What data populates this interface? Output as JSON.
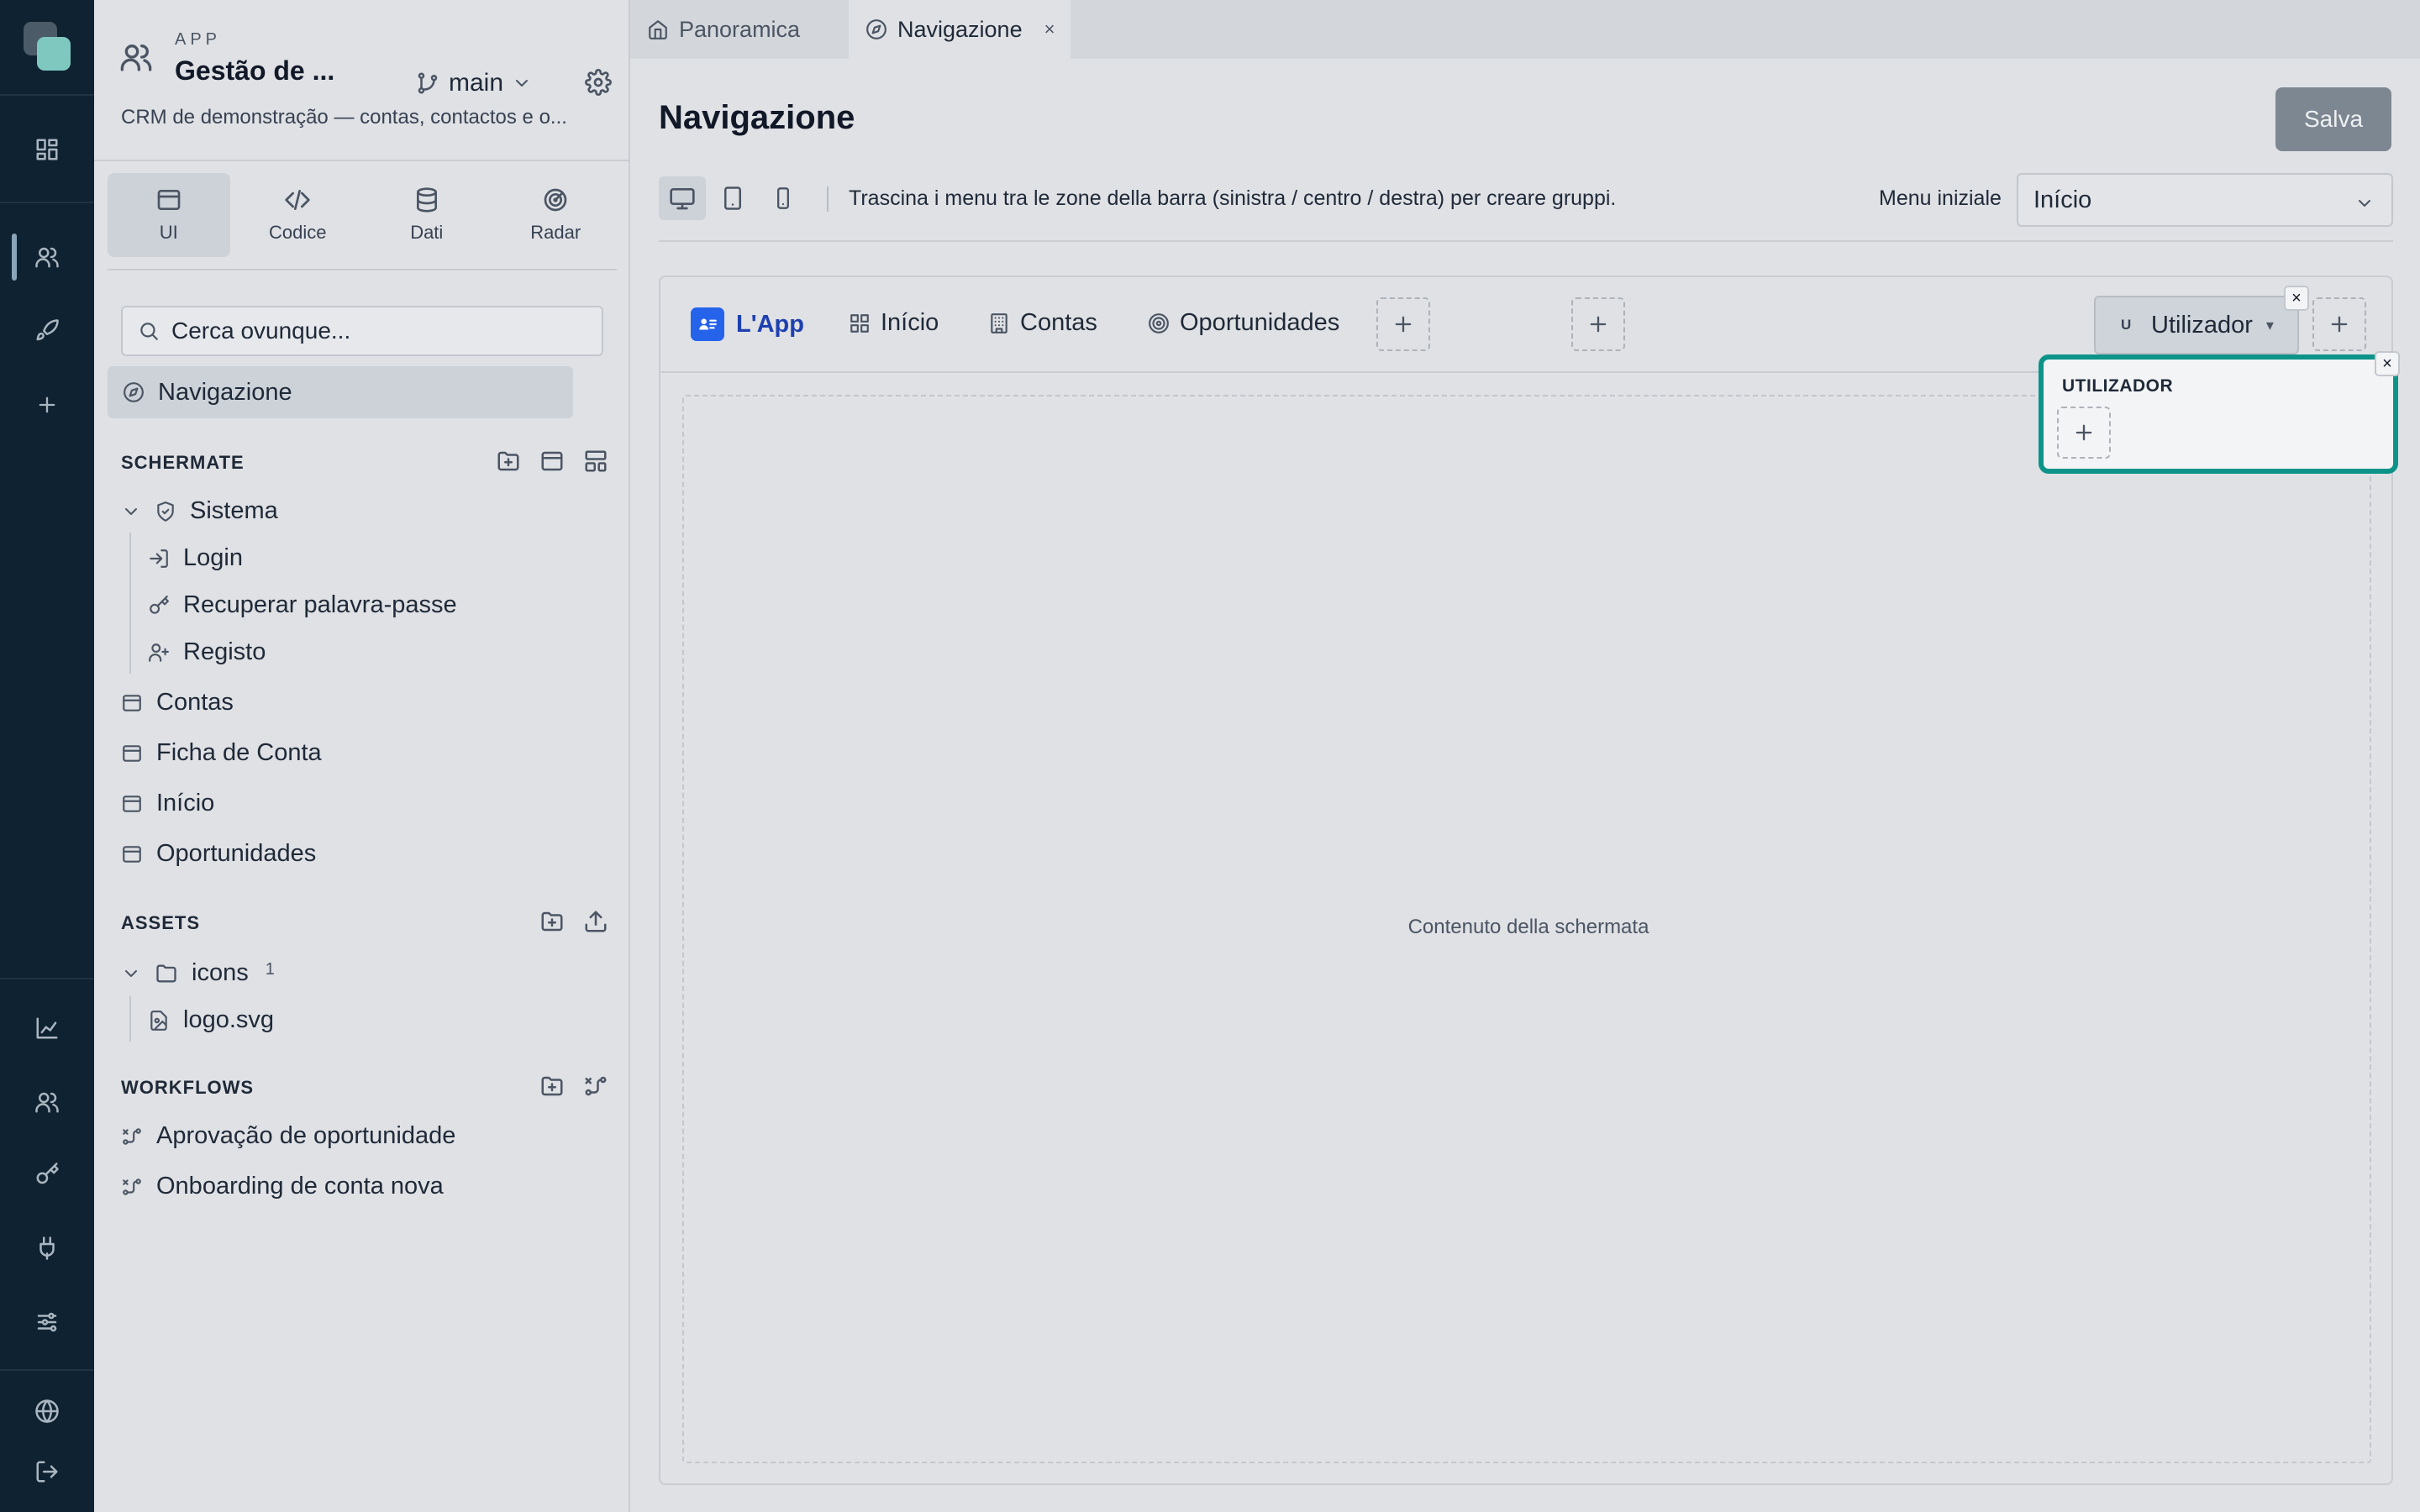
{
  "app": {
    "label": "APP",
    "title": "Gestão de ...",
    "description": "CRM de demonstração — contas, contactos e o...",
    "branch": "main"
  },
  "modes": [
    {
      "label": "UI",
      "icon": "window-icon"
    },
    {
      "label": "Codice",
      "icon": "code-icon"
    },
    {
      "label": "Dati",
      "icon": "database-icon"
    },
    {
      "label": "Radar",
      "icon": "radar-icon"
    }
  ],
  "search": {
    "placeholder": "Cerca ovunque..."
  },
  "nav_item": "Navigazione",
  "sections": {
    "screens": "SCHERMATE",
    "assets": "ASSETS",
    "workflows": "WORKFLOWS"
  },
  "screens": {
    "group": "Sistema",
    "children": [
      "Login",
      "Recuperar palavra-passe",
      "Registo"
    ],
    "items": [
      "Contas",
      "Ficha de Conta",
      "Início",
      "Oportunidades"
    ]
  },
  "assets": {
    "folder": "icons",
    "count": "1",
    "files": [
      "logo.svg"
    ]
  },
  "workflows": [
    "Aprovação de oportunidade",
    "Onboarding de conta nova"
  ],
  "tabs": [
    {
      "label": "Panoramica",
      "icon": "home-icon"
    },
    {
      "label": "Navigazione",
      "icon": "compass-icon",
      "close": "×"
    }
  ],
  "page": {
    "title": "Navigazione",
    "save_label": "Salva"
  },
  "toolbar": {
    "hint": "Trascina i menu tra le zone della barra (sinistra / centro / destra) per creare gruppi.",
    "menu_label": "Menu iniziale",
    "menu_value": "Início"
  },
  "preview": {
    "brand": "L'App",
    "items": [
      "Início",
      "Contas",
      "Oportunidades"
    ],
    "user_initial": "U",
    "user_label": "Utilizador",
    "caret": "▾",
    "content_label": "Contenuto della schermata",
    "dropdown_title": "UTILIZADOR",
    "close": "×"
  },
  "colors": {
    "rail_bg": "#0f2231",
    "accent_teal": "#0d9488",
    "brand_blue": "#2563eb",
    "save_bg": "#7d8792"
  }
}
